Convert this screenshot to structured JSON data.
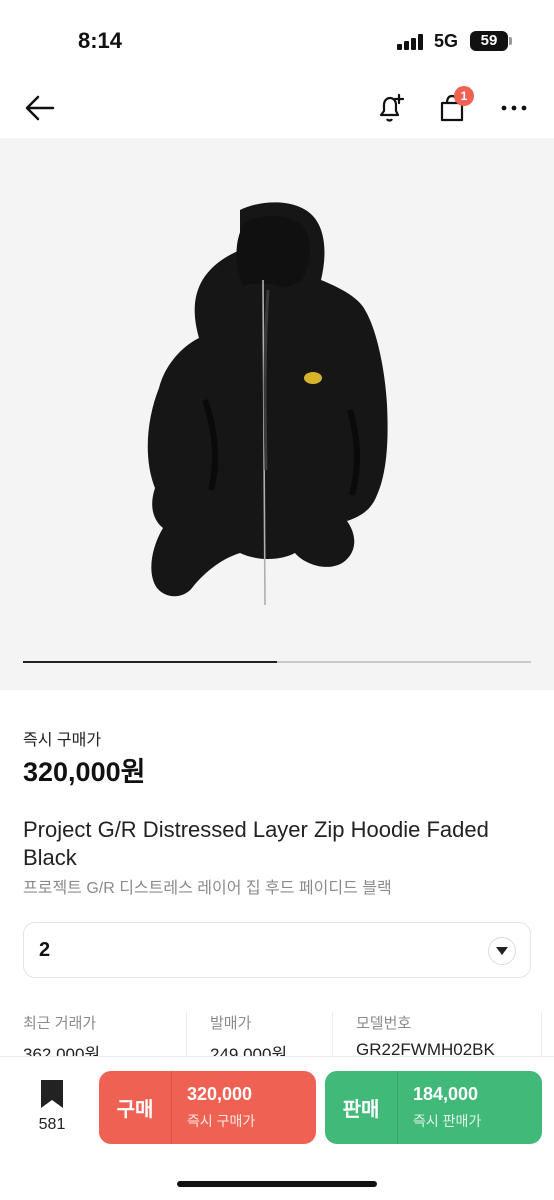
{
  "status_bar": {
    "time": "8:14",
    "network": "5G",
    "battery": "59"
  },
  "nav": {
    "icons": [
      "back-arrow-icon",
      "bell-plus-icon",
      "shopping-bag-icon",
      "more-icon"
    ],
    "cart_badge": "1"
  },
  "gallery": {
    "progress": 0.5
  },
  "product": {
    "price_label": "즉시 구매가",
    "price": "320,000원",
    "title_en": "Project G/R Distressed Layer Zip Hoodie Faded Black",
    "title_ko": "프로젝트 G/R 디스트레스 레이어 집 후드 페이디드 블랙"
  },
  "size": {
    "selected": "2"
  },
  "stats": [
    {
      "label": "최근 거래가",
      "value": "362,000원"
    },
    {
      "label": "발매가",
      "value": "249,000원"
    },
    {
      "label": "모델번호",
      "value": "GR22FWMH02BK"
    }
  ],
  "bottom": {
    "wish_count": "581",
    "buy": {
      "label": "구매",
      "price": "320,000",
      "sub": "즉시 구매가",
      "color": "#ef6253"
    },
    "sell": {
      "label": "판매",
      "price": "184,000",
      "sub": "즉시 판매가",
      "color": "#41b979"
    }
  }
}
